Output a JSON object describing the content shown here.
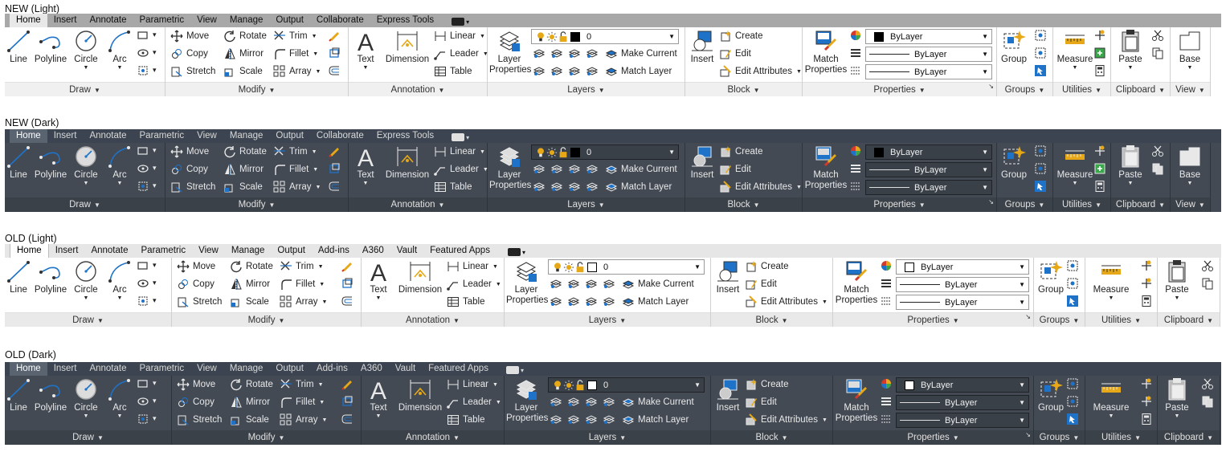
{
  "sections": [
    {
      "title": "NEW (Light)",
      "theme": "light",
      "version": "new"
    },
    {
      "title": "NEW (Dark)",
      "theme": "dark",
      "version": "new"
    },
    {
      "title": "OLD (Light)",
      "theme": "light",
      "version": "old"
    },
    {
      "title": "OLD (Dark)",
      "theme": "dark",
      "version": "old"
    }
  ],
  "tabs_new": [
    "Home",
    "Insert",
    "Annotate",
    "Parametric",
    "View",
    "Manage",
    "Output",
    "Collaborate",
    "Express Tools"
  ],
  "tabs_old": [
    "Home",
    "Insert",
    "Annotate",
    "Parametric",
    "View",
    "Manage",
    "Output",
    "Add-ins",
    "A360",
    "Vault",
    "Featured Apps"
  ],
  "draw": {
    "line": "Line",
    "polyline": "Polyline",
    "circle": "Circle",
    "arc": "Arc",
    "footer": "Draw"
  },
  "modify": {
    "move": "Move",
    "rotate": "Rotate",
    "trim": "Trim",
    "copy": "Copy",
    "mirror": "Mirror",
    "fillet": "Fillet",
    "stretch": "Stretch",
    "scale": "Scale",
    "array": "Array",
    "footer": "Modify"
  },
  "annotation": {
    "text": "Text",
    "dimension": "Dimension",
    "linear": "Linear",
    "leader": "Leader",
    "table": "Table",
    "footer": "Annotation"
  },
  "layers": {
    "properties": "Layer\nProperties",
    "layer_value": "0",
    "make_current": "Make Current",
    "match_layer": "Match Layer",
    "footer": "Layers"
  },
  "block": {
    "insert": "Insert",
    "create": "Create",
    "edit": "Edit",
    "edit_attributes": "Edit Attributes",
    "footer": "Block"
  },
  "properties": {
    "match": "Match\nProperties",
    "color": "ByLayer",
    "linetype": "ByLayer",
    "lineweight": "ByLayer",
    "footer": "Properties"
  },
  "groups": {
    "group": "Group",
    "footer": "Groups"
  },
  "utilities": {
    "measure": "Measure",
    "footer": "Utilities"
  },
  "clipboard": {
    "paste": "Paste",
    "footer": "Clipboard"
  },
  "view": {
    "base": "Base",
    "footer": "View"
  },
  "colors": {
    "accent_blue": "#1e73c8",
    "icon_gold": "#e6a817",
    "icon_red": "#d43a2a"
  }
}
